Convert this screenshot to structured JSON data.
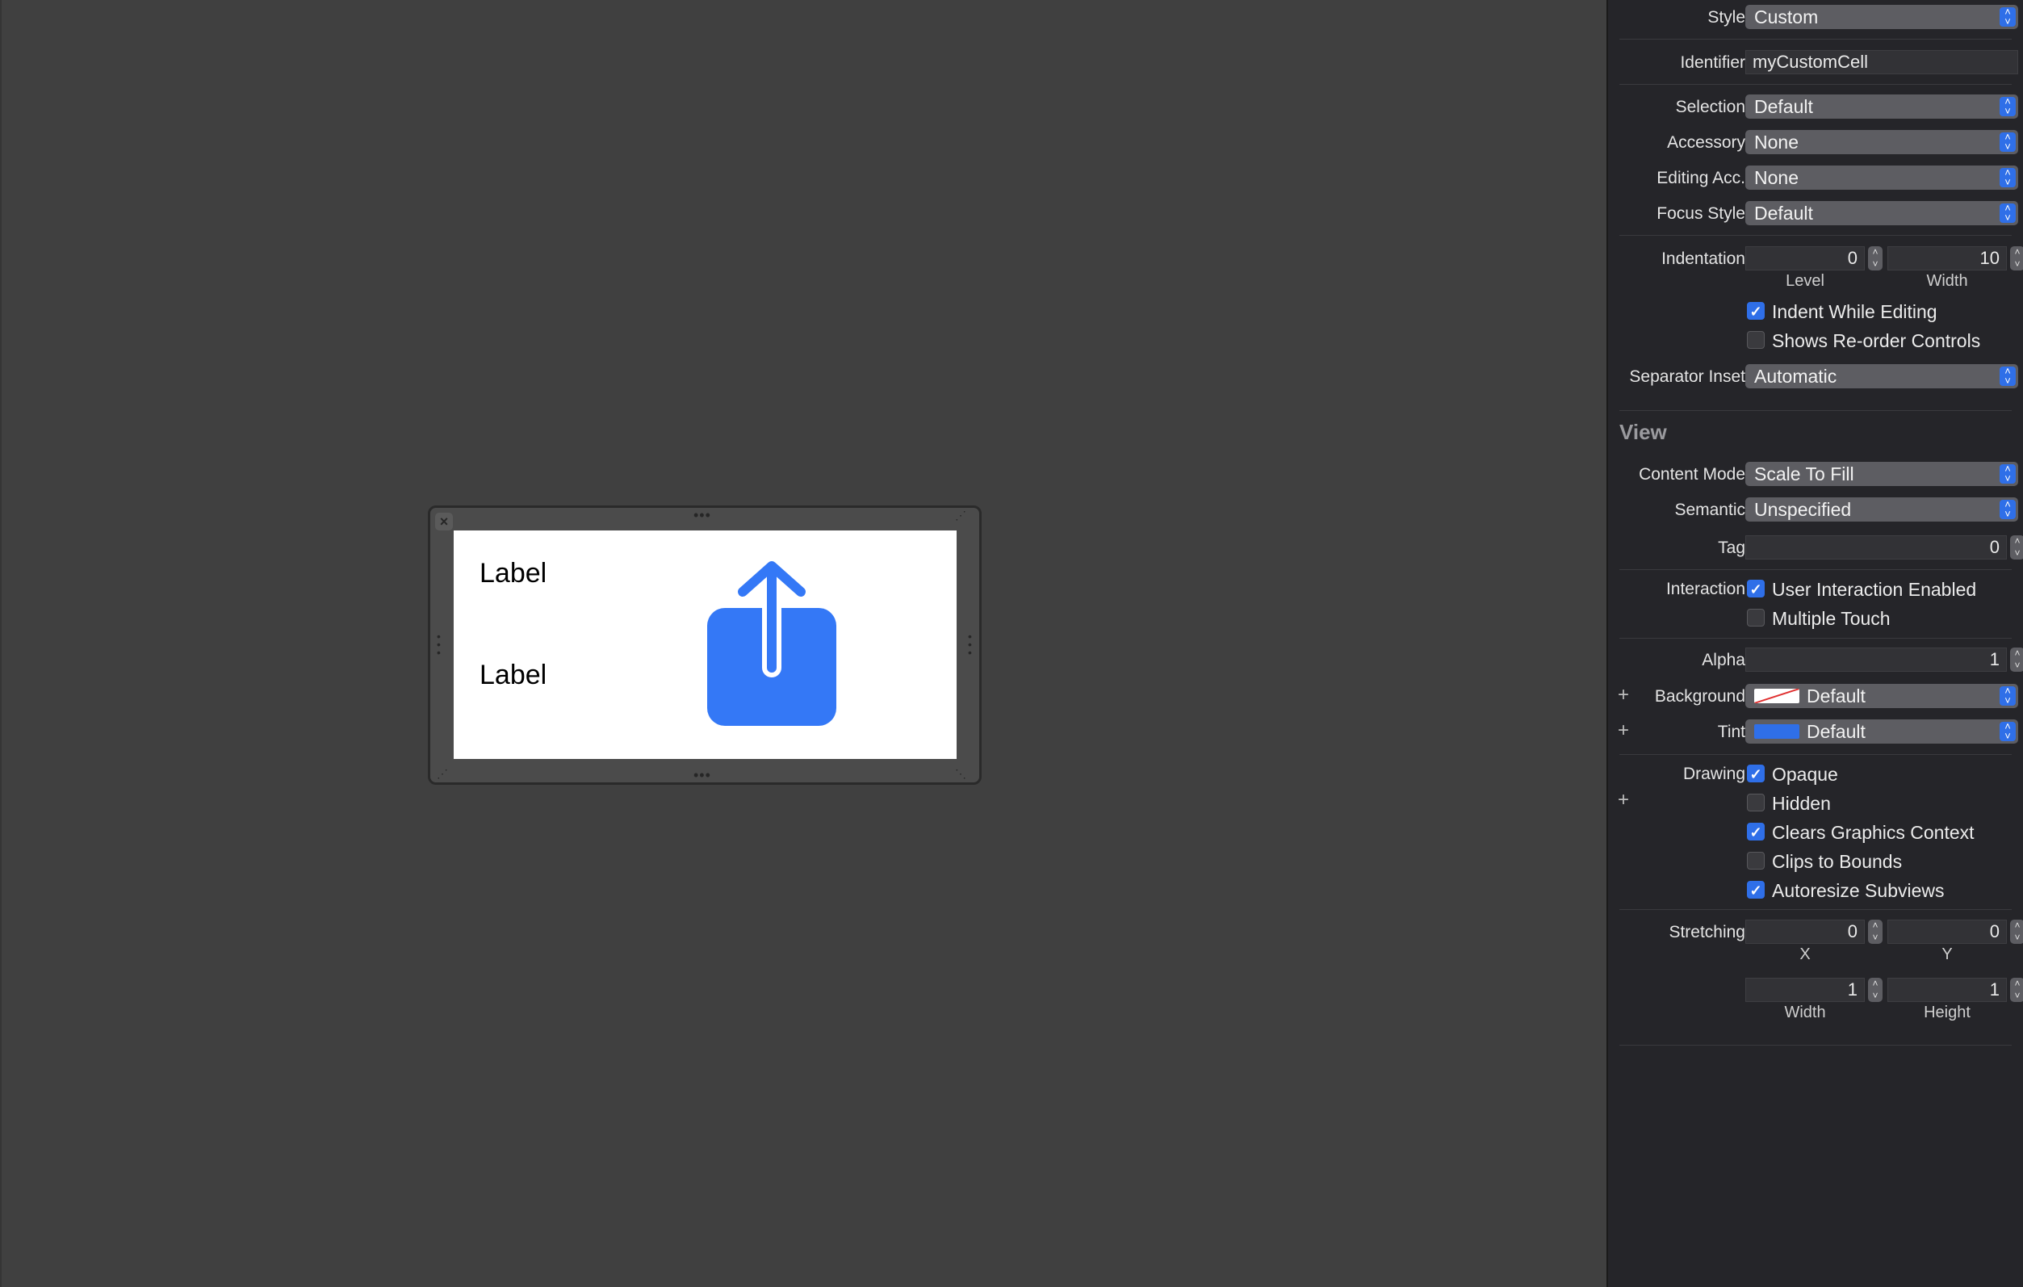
{
  "canvas": {
    "cell": {
      "label_top": "Label",
      "label_bottom": "Label",
      "icon": "share-icon"
    }
  },
  "inspector": {
    "style": {
      "label": "Style",
      "value": "Custom"
    },
    "identifier": {
      "label": "Identifier",
      "value": "myCustomCell"
    },
    "selection": {
      "label": "Selection",
      "value": "Default"
    },
    "accessory": {
      "label": "Accessory",
      "value": "None"
    },
    "editing_acc": {
      "label": "Editing Acc.",
      "value": "None"
    },
    "focus_style": {
      "label": "Focus Style",
      "value": "Default"
    },
    "indentation": {
      "label": "Indentation",
      "level": "0",
      "level_caption": "Level",
      "width": "10",
      "width_caption": "Width"
    },
    "indent_while_editing": {
      "label": "Indent While Editing",
      "checked": true
    },
    "shows_reorder": {
      "label": "Shows Re-order Controls",
      "checked": false
    },
    "separator_inset": {
      "label": "Separator Inset",
      "value": "Automatic"
    },
    "view_section": "View",
    "content_mode": {
      "label": "Content Mode",
      "value": "Scale To Fill"
    },
    "semantic": {
      "label": "Semantic",
      "value": "Unspecified"
    },
    "tag": {
      "label": "Tag",
      "value": "0"
    },
    "interaction": {
      "label": "Interaction",
      "user_interaction": "User Interaction Enabled",
      "multiple_touch": "Multiple Touch"
    },
    "alpha": {
      "label": "Alpha",
      "value": "1"
    },
    "background": {
      "label": "Background",
      "value": "Default"
    },
    "tint": {
      "label": "Tint",
      "value": "Default",
      "color": "#2f6fe8"
    },
    "drawing": {
      "label": "Drawing",
      "opaque": "Opaque",
      "hidden": "Hidden",
      "clears": "Clears Graphics Context",
      "clips": "Clips to Bounds",
      "autoresize": "Autoresize Subviews"
    },
    "stretching": {
      "label": "Stretching",
      "x": "0",
      "x_caption": "X",
      "y": "0",
      "y_caption": "Y",
      "width": "1",
      "width_caption": "Width",
      "height": "1",
      "height_caption": "Height"
    }
  }
}
